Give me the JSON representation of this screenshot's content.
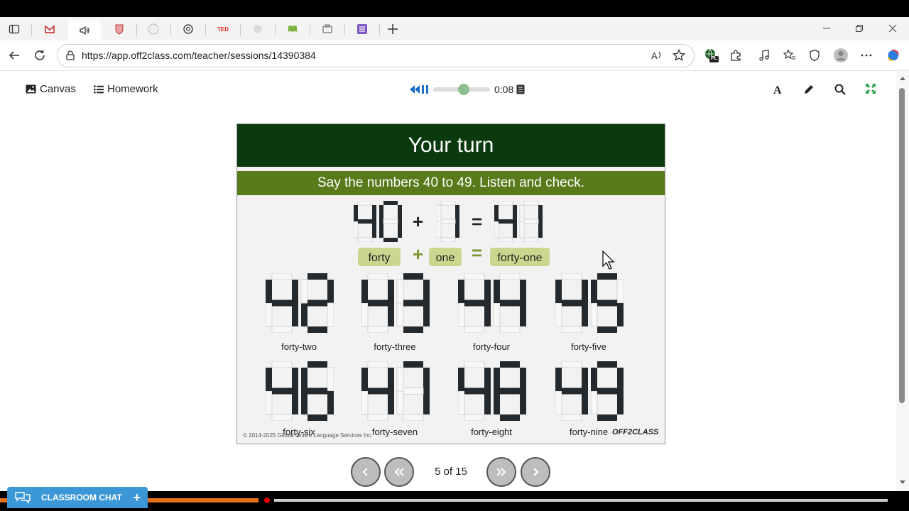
{
  "browser": {
    "tabs": [
      {
        "icon": "window-icon"
      },
      {
        "icon": "gmail-icon"
      },
      {
        "icon": "speaker-icon",
        "active": true
      },
      {
        "icon": "shield-crest-icon"
      },
      {
        "icon": "circle-tab-icon"
      },
      {
        "icon": "openai-icon"
      },
      {
        "icon": "ted-icon",
        "label": "TED"
      },
      {
        "icon": "gray-tab-icon"
      },
      {
        "icon": "book-icon"
      },
      {
        "icon": "folder-icon"
      },
      {
        "icon": "list-icon"
      }
    ],
    "url": "https://app.off2class.com/teacher/sessions/14390384",
    "profile_badge": "PL"
  },
  "topnav": {
    "canvas_label": "Canvas",
    "homework_label": "Homework",
    "audio_time": "0:08",
    "audio_progress": 0.55
  },
  "slide": {
    "title": "Your turn",
    "instruction": "Say the numbers 40 to 49. Listen and check.",
    "equation": {
      "a_digits": "40",
      "b_digits": "1",
      "result_digits": "41",
      "plus": "+",
      "equals": "=",
      "a_word": "forty",
      "b_word": "one",
      "result_word": "forty-one"
    },
    "numbers": [
      {
        "digits": "42",
        "word": "forty-two"
      },
      {
        "digits": "43",
        "word": "forty-three"
      },
      {
        "digits": "44",
        "word": "forty-four"
      },
      {
        "digits": "45",
        "word": "forty-five"
      },
      {
        "digits": "46",
        "word": "forty-six"
      },
      {
        "digits": "47",
        "word": "forty-seven"
      },
      {
        "digits": "48",
        "word": "forty-eight"
      },
      {
        "digits": "49",
        "word": "forty-nine"
      }
    ],
    "copyright": "© 2014-2025 Global Online Language Services Inc.",
    "brand": "OFF2CLASS"
  },
  "pager": {
    "counter": "5 of 15"
  },
  "chat": {
    "label": "CLASSROOM CHAT",
    "add": "+"
  },
  "session_progress": 0.29,
  "colors": {
    "slide_title_bg": "#0a3a0e",
    "slide_sub_bg": "#587a1b",
    "pill_bg": "#c9d78f",
    "chat_bg": "#3c97d6",
    "progress_orange": "#e8721c",
    "progress_dot": "#e00000"
  }
}
